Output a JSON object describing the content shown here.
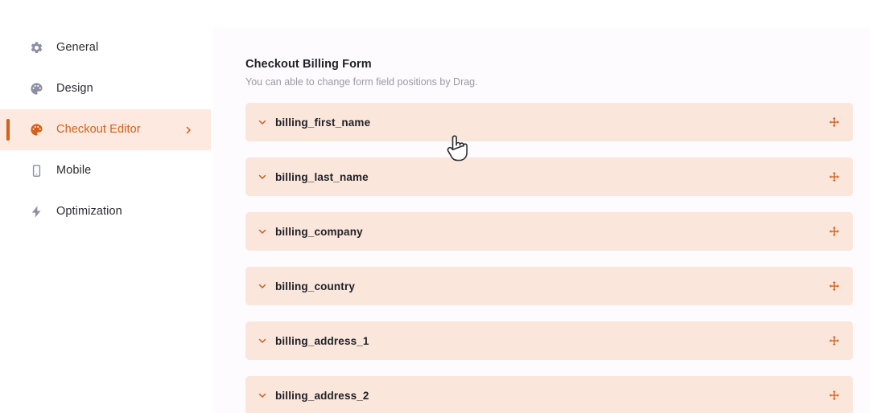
{
  "sidebar": {
    "items": [
      {
        "label": "General",
        "icon": "gear-icon",
        "active": false
      },
      {
        "label": "Design",
        "icon": "palette-icon",
        "active": false
      },
      {
        "label": "Checkout Editor",
        "icon": "palette-icon",
        "active": true
      },
      {
        "label": "Mobile",
        "icon": "mobile-icon",
        "active": false
      },
      {
        "label": "Optimization",
        "icon": "lightning-icon",
        "active": false
      }
    ]
  },
  "main": {
    "title": "Checkout Billing Form",
    "subtitle": "You can able to change form field positions by Drag.",
    "fields": [
      {
        "name": "billing_first_name"
      },
      {
        "name": "billing_last_name"
      },
      {
        "name": "billing_company"
      },
      {
        "name": "billing_country"
      },
      {
        "name": "billing_address_1"
      },
      {
        "name": "billing_address_2"
      }
    ]
  },
  "colors": {
    "accent": "#d2601a",
    "row_background": "#fbe6db",
    "active_nav_background": "#fde9df",
    "panel_background": "#fdfbfd",
    "muted_text": "#9a9aa4",
    "body_text": "#1f2026"
  },
  "cursor": {
    "type": "pointer-hand-cursor"
  }
}
